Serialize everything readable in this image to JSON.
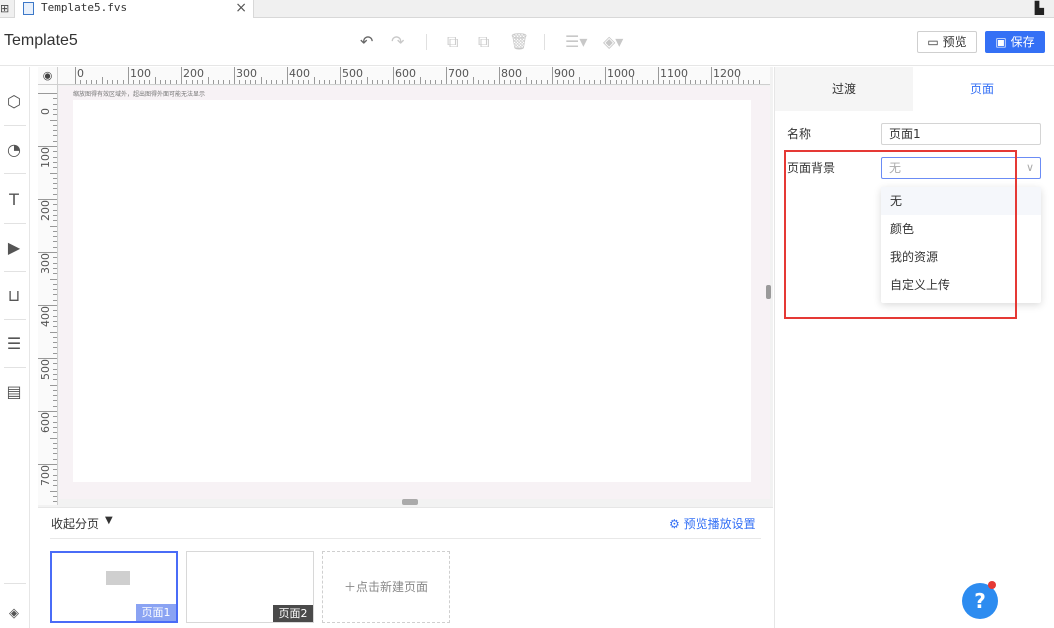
{
  "tabbar": {
    "file_name": "Template5.fvs",
    "close_glyph": "×"
  },
  "toolbar": {
    "title": "Template5",
    "preview_label": "预览",
    "save_label": "保存"
  },
  "canvas": {
    "ruler_top_labels": [
      "0",
      "100",
      "200",
      "300",
      "400",
      "500",
      "600",
      "700",
      "800",
      "900",
      "1000",
      "1100",
      "1200"
    ],
    "ruler_left_labels": [
      "0",
      "100",
      "200",
      "300",
      "400",
      "500",
      "600",
      "700"
    ],
    "hint": "缩放图得有效区域外，超出图得外面可能无法显示"
  },
  "pages_panel": {
    "collapse_label": "收起分页",
    "play_settings_label": "预览播放设置",
    "pages": [
      {
        "label": "页面1",
        "active": true
      },
      {
        "label": "页面2",
        "active": false
      }
    ],
    "new_page_label": "点击新建页面"
  },
  "right_panel": {
    "tabs": [
      {
        "label": "过渡",
        "active": false
      },
      {
        "label": "页面",
        "active": true
      }
    ],
    "name_label": "名称",
    "name_value": "页面1",
    "bg_label": "页面背景",
    "bg_value": "无",
    "bg_options": [
      "无",
      "颜色",
      "我的资源",
      "自定义上传"
    ],
    "help_glyph": "?"
  },
  "colors": {
    "accent": "#3470f5",
    "highlight_border": "#e53935"
  }
}
